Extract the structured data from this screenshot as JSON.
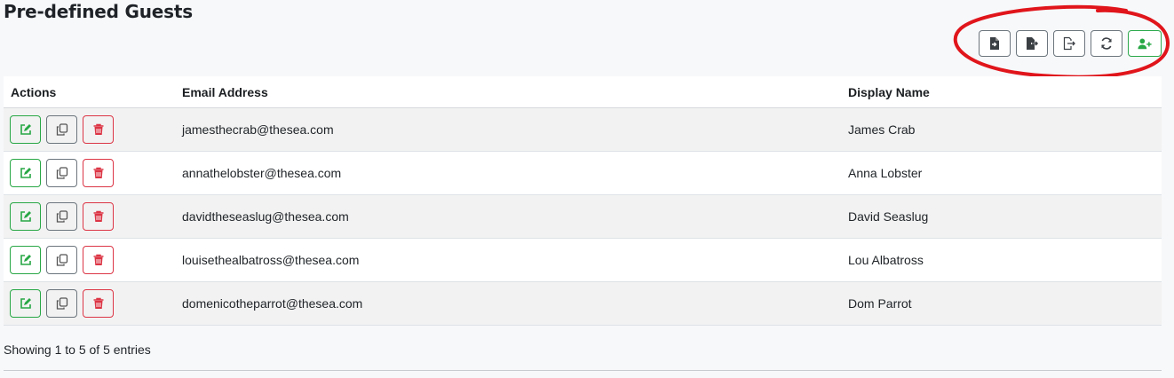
{
  "page": {
    "title": "Pre-defined Guests"
  },
  "toolbar": {
    "buttons": [
      {
        "icon": "file-import-icon"
      },
      {
        "icon": "file-export-icon"
      },
      {
        "icon": "file-export-outline-icon"
      },
      {
        "icon": "refresh-icon"
      },
      {
        "icon": "add-user-icon"
      }
    ]
  },
  "table": {
    "columns": [
      "Actions",
      "Email Address",
      "Display Name"
    ],
    "rows": [
      {
        "email": "jamesthecrab@thesea.com",
        "name": "James Crab"
      },
      {
        "email": "annathelobster@thesea.com",
        "name": "Anna Lobster"
      },
      {
        "email": "davidtheseaslug@thesea.com",
        "name": "David Seaslug"
      },
      {
        "email": "louisethealbatross@thesea.com",
        "name": "Lou Albatross"
      },
      {
        "email": "domenicotheparrot@thesea.com",
        "name": "Dom Parrot"
      }
    ]
  },
  "footer": {
    "info": "Showing 1 to 5 of 5 entries"
  },
  "colors": {
    "success": "#28a745",
    "danger": "#dc3545",
    "secondary": "#6c757d",
    "annotation": "#e0151b"
  }
}
